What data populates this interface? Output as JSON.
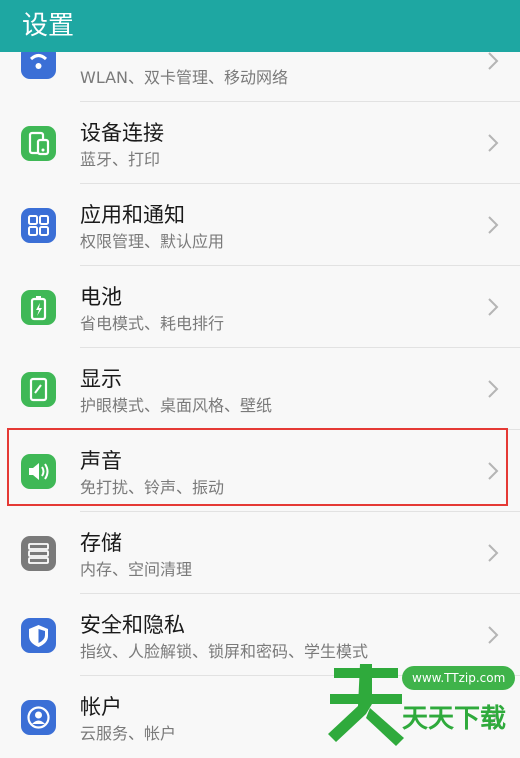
{
  "header": {
    "title": "设置"
  },
  "items": [
    {
      "title": "",
      "subtitle": "WLAN、双卡管理、移动网络",
      "icon": "wifi-icon",
      "color": "#3b6fd6"
    },
    {
      "title": "设备连接",
      "subtitle": "蓝牙、打印",
      "icon": "device-connection-icon",
      "color": "#3fb856"
    },
    {
      "title": "应用和通知",
      "subtitle": "权限管理、默认应用",
      "icon": "apps-grid-icon",
      "color": "#3b6fd6"
    },
    {
      "title": "电池",
      "subtitle": "省电模式、耗电排行",
      "icon": "battery-icon",
      "color": "#3fb856"
    },
    {
      "title": "显示",
      "subtitle": "护眼模式、桌面风格、壁纸",
      "icon": "display-icon",
      "color": "#3fb856"
    },
    {
      "title": "声音",
      "subtitle": "免打扰、铃声、振动",
      "icon": "speaker-icon",
      "color": "#3fb856"
    },
    {
      "title": "存储",
      "subtitle": "内存、空间清理",
      "icon": "storage-icon",
      "color": "#7a7a7a"
    },
    {
      "title": "安全和隐私",
      "subtitle": "指纹、人脸解锁、锁屏和密码、学生模式",
      "icon": "shield-icon",
      "color": "#3b6fd6"
    },
    {
      "title": "帐户",
      "subtitle": "云服务、帐户",
      "icon": "account-icon",
      "color": "#3b6fd6"
    }
  ],
  "watermark": {
    "url": "www.TTzip.com",
    "text": "天天下载"
  }
}
